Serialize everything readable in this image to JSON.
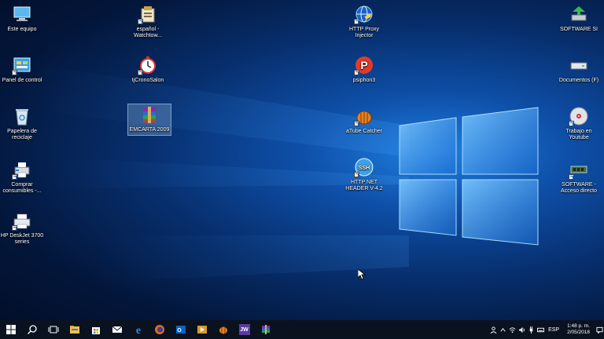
{
  "desktop": {
    "icons": {
      "este_equipo": "Este equipo",
      "panel_control": "Panel de control",
      "papelera": "Papelera de reciclaje",
      "comprar": "Comprar consumibles -...",
      "hp_deskjet": "HP DeskJet 3700 series",
      "espanol": "español - Watchtow...",
      "tjcrono": "tjCronoSalon",
      "emcarta": "EMCARTA 2009",
      "http_proxy": "HTTP Proxy Injector",
      "psiphon": "psiphon3",
      "atube": "aTube Catcher",
      "http_net": "HTTP NET HEADER V-4.2",
      "software_si": "SOFTWARE SI",
      "documentos": "Documentos (F)",
      "trabajo": "Trabajo en Youtube",
      "software_acceso": "SOFTWARE - Acceso directo"
    }
  },
  "taskbar": {
    "icons": [
      "start-icon",
      "search-icon",
      "task-view-icon",
      "file-explorer-icon",
      "store-icon",
      "mail-icon",
      "edge-icon",
      "firefox-icon",
      "outlook-icon",
      "media-player-icon",
      "atube-taskbar-icon",
      "jw-icon",
      "winrar-taskbar-icon"
    ],
    "jw_label": "JW",
    "language": "ESP",
    "time": "1:48 p. m.",
    "date": "2/05/2018"
  },
  "colors": {
    "taskbar": "#0a1220",
    "accent": "#1f7fe0"
  }
}
